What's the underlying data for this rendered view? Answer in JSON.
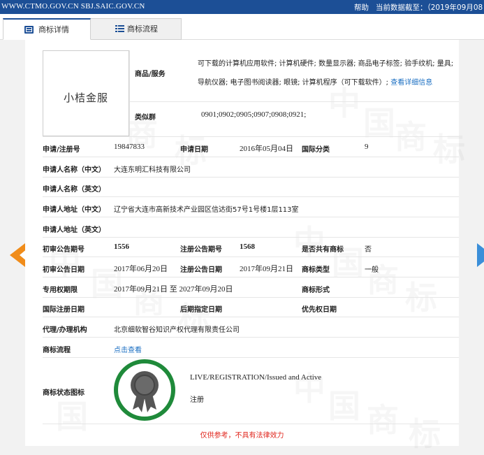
{
  "topbar": {
    "site": "WWW.CTMO.GOV.CN SBJ.SAIC.GOV.CN",
    "help": "帮助",
    "date_text": "当前数据截至：（2019年09月08日）"
  },
  "tabs": [
    {
      "label": "商标详情",
      "icon": "list-detail-icon"
    },
    {
      "label": "商标流程",
      "icon": "list-flow-icon"
    }
  ],
  "logo_text": "小桔金服",
  "goods_label": "商品/服务",
  "goods_text": "可下载的计算机应用软件; 计算机硬件; 数量显示器; 商品电子标签; 验手纹机; 量具; 导航仪器; 电子图书阅读器; 眼镜; 计算机程序（可下载软件）;",
  "goods_link": "查看详细信息",
  "similar_group_label": "类似群",
  "similar_group": "0901;0902;0905;0907;0908;0921;",
  "fields": {
    "reg_no_label": "申请/注册号",
    "reg_no": "19847833",
    "app_date_label": "申请日期",
    "app_date": "2016年05月04日",
    "intl_class_label": "国际分类",
    "intl_class": "9",
    "applicant_cn_label": "申请人名称（中文）",
    "applicant_cn": "大连东明汇科技有限公司",
    "applicant_en_label": "申请人名称（英文）",
    "applicant_en": "",
    "address_cn_label": "申请人地址（中文）",
    "address_cn": "辽宁省大连市高新技术产业园区信达街57号1号楼1层113室",
    "address_en_label": "申请人地址（英文）",
    "address_en": "",
    "prelim_no_label": "初审公告期号",
    "prelim_no": "1556",
    "reg_pub_no_label": "注册公告期号",
    "reg_pub_no": "1568",
    "shared_label": "是否共有商标",
    "shared": "否",
    "prelim_date_label": "初审公告日期",
    "prelim_date": "2017年06月20日",
    "reg_pub_date_label": "注册公告日期",
    "reg_pub_date": "2017年09月21日",
    "tm_type_label": "商标类型",
    "tm_type": "一般",
    "exclusive_label": "专用权期限",
    "exclusive": "2017年09月21日 至 2027年09月20日",
    "tm_form_label": "商标形式",
    "tm_form": "",
    "intl_reg_date_label": "国际注册日期",
    "intl_reg_date": "",
    "later_date_label": "后期指定日期",
    "later_date": "",
    "priority_date_label": "优先权日期",
    "priority_date": "",
    "agent_label": "代理/办理机构",
    "agent": "北京细软智谷知识产权代理有限责任公司",
    "flow_label": "商标流程",
    "flow_link": "点击查看",
    "status_label": "商标状态图标",
    "status_en": "LIVE/REGISTRATION/Issued and Active",
    "status_cn": "注册"
  },
  "watermark": [
    "中",
    "国",
    "商",
    "标"
  ],
  "disclaimer": "仅供参考，不具有法律效力",
  "colors": {
    "topbar": "#1c4f96",
    "link": "#1a6ec2",
    "badge": "#1f8a3a",
    "prev_arrow": "#f08c1a",
    "next_arrow": "#3b8fd9",
    "disclaimer": "#e0241b"
  }
}
